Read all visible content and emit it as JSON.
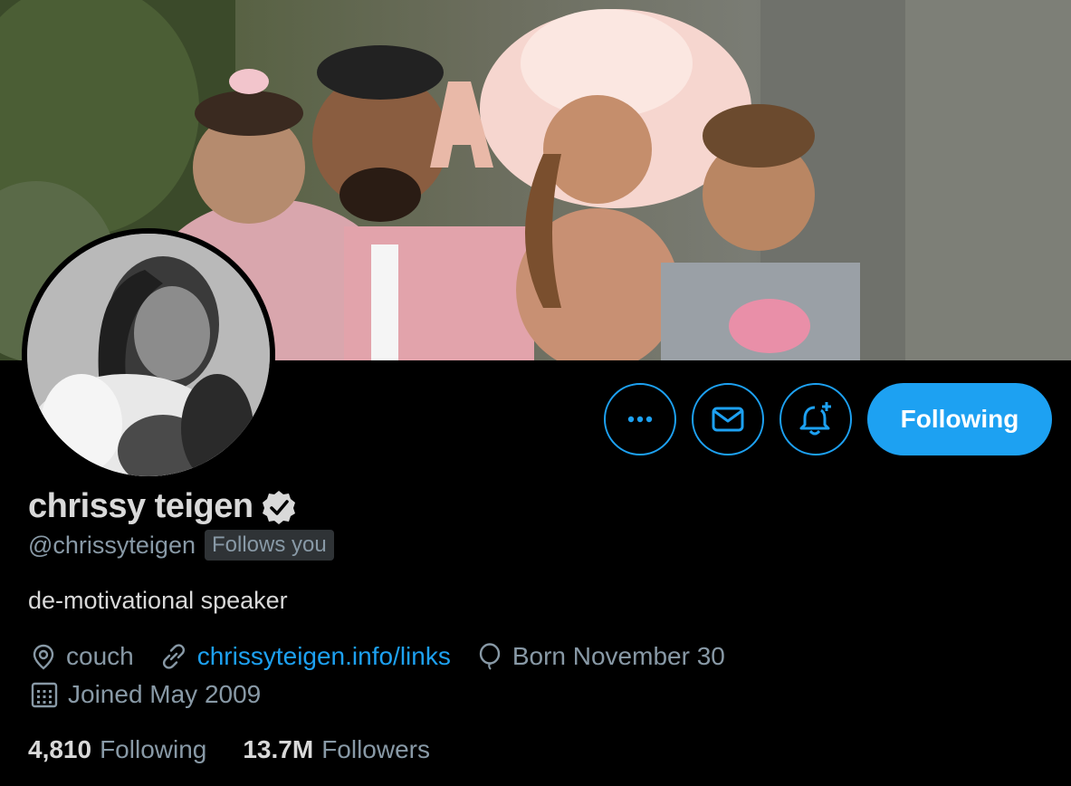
{
  "header": {
    "banner_icon": "family-photo-banner",
    "avatar_icon": "profile-photo-avatar"
  },
  "actions": {
    "more_icon": "more-dots-icon",
    "message_icon": "envelope-icon",
    "notify_icon": "bell-plus-icon",
    "following_label": "Following"
  },
  "profile": {
    "display_name": "chrissy teigen",
    "verified_icon": "verified-badge-icon",
    "handle": "@chrissyteigen",
    "follows_you": "Follows you",
    "bio": "de-motivational speaker",
    "location": "couch",
    "website": "chrissyteigen.info/links",
    "birthday": "Born November 30",
    "joined": "Joined May 2009"
  },
  "stats": {
    "following_count": "4,810",
    "following_label": "Following",
    "followers_count": "13.7M",
    "followers_label": "Followers"
  },
  "colors": {
    "accent": "#1da1f2",
    "background": "#000000",
    "primary_text": "#d9d9d9",
    "secondary_text": "#8899a6",
    "badge_bg": "#2f3336"
  }
}
